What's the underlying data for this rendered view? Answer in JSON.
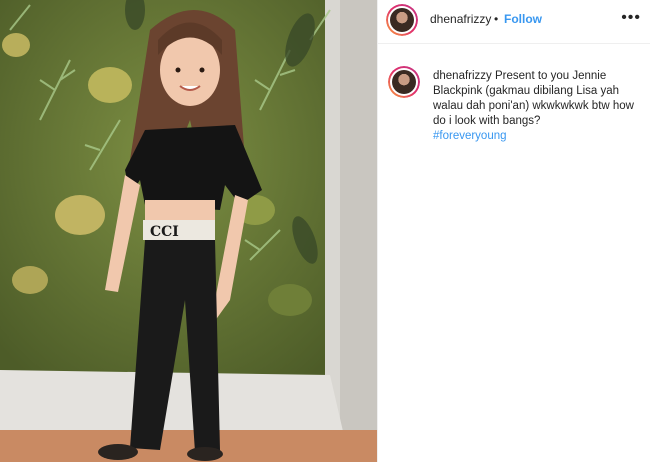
{
  "post": {
    "username": "dhenafrizzy",
    "separator": "•",
    "follow_label": "Follow",
    "more_label": "•••",
    "caption_username": "dhenafrizzy",
    "caption_text": "Present to you Jennie Blackpink (gakmau dibilang Lisa yah walau dah poni'an) wkwkwkwk btw how do i look with bangs?",
    "hashtag": "#foreveryoung"
  },
  "photo": {
    "description_icon": "photo-image"
  },
  "colors": {
    "link": "#3897f0",
    "text": "#262626",
    "border": "#efefef"
  }
}
